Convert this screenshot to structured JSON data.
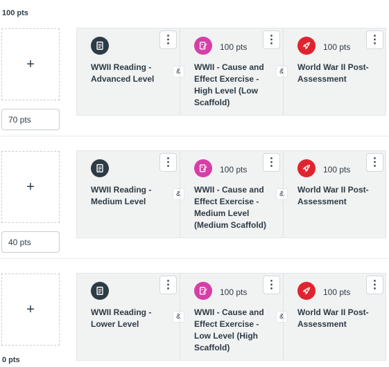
{
  "score_labels": {
    "top": "100 pts",
    "bottom": "0 pts"
  },
  "connector": "&",
  "add_symbol": "+",
  "menu_symbol": "⋮",
  "colors": {
    "reading": "#2d3b45",
    "exercise": "#d63fa7",
    "assessment": "#e0242f"
  },
  "sections": [
    {
      "threshold": "70 pts",
      "cards": [
        {
          "icon": "assignment-icon",
          "points": "",
          "title": "WWII Reading - Advanced Level"
        },
        {
          "icon": "quiz-icon",
          "points": "100 pts",
          "title": "WWII - Cause and Effect Exercise - High Level (Low Scaffold)"
        },
        {
          "icon": "rocket-icon",
          "points": "100 pts",
          "title": "World War II Post-Assessment"
        }
      ]
    },
    {
      "threshold": "40 pts",
      "cards": [
        {
          "icon": "assignment-icon",
          "points": "",
          "title": "WWII Reading - Medium Level"
        },
        {
          "icon": "quiz-icon",
          "points": "100 pts",
          "title": "WWII - Cause and Effect Exercise - Medium Level (Medium Scaffold)"
        },
        {
          "icon": "rocket-icon",
          "points": "100 pts",
          "title": "World War II Post-Assessment"
        }
      ]
    },
    {
      "threshold": "",
      "cards": [
        {
          "icon": "assignment-icon",
          "points": "",
          "title": "WWII Reading - Lower Level"
        },
        {
          "icon": "quiz-icon",
          "points": "100 pts",
          "title": "WWII - Cause and Effect Exercise - Low Level (High Scaffold)"
        },
        {
          "icon": "rocket-icon",
          "points": "100 pts",
          "title": "World War II Post-Assessment"
        }
      ]
    }
  ]
}
